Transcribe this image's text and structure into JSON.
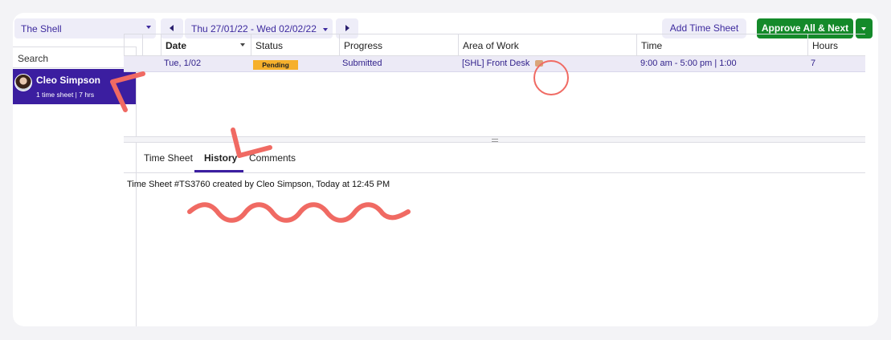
{
  "toolbar": {
    "venue": "The Shell",
    "date_range": "Thu 27/01/22 - Wed 02/02/22",
    "add_time_sheet": "Add Time Sheet",
    "approve_all_next": "Approve All & Next"
  },
  "sidebar": {
    "search_placeholder": "Search",
    "people": [
      {
        "name": "Cleo Simpson",
        "summary": "1 time sheet | 7 hrs"
      }
    ]
  },
  "grid": {
    "columns": [
      "Date",
      "Status",
      "Progress",
      "Area of Work",
      "Time",
      "Hours"
    ],
    "rows": [
      {
        "date": "Tue, 1/02",
        "status": "Pending",
        "progress": "Submitted",
        "area": "[SHL] Front Desk",
        "time": "9:00 am - 5:00 pm | 1:00",
        "hours": "7"
      }
    ]
  },
  "tabs": [
    {
      "label": "Time Sheet"
    },
    {
      "label": "History"
    },
    {
      "label": "Comments"
    }
  ],
  "history": {
    "entry": "Time Sheet #TS3760  created by Cleo Simpson, Today at 12:45 PM"
  },
  "colors": {
    "accent": "#3b1ea0",
    "approve_green": "#148a2a",
    "pending": "#f6b02c",
    "annotation": "#f06a63"
  },
  "icons": [
    "avatar",
    "chevron-left-icon",
    "chevron-right-icon",
    "chevron-down-icon",
    "note-icon"
  ]
}
